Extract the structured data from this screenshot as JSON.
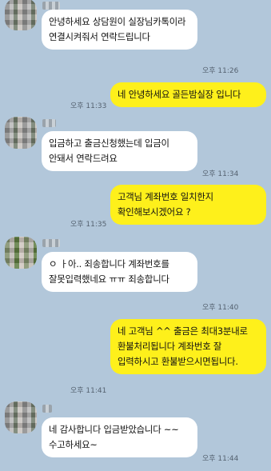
{
  "messages": [
    {
      "side": "in",
      "text": "안녕하세요 상담원이 실장님카톡이라 연결시켜줘서 연락드립니다",
      "time": "오후 11:26"
    },
    {
      "side": "out",
      "text": "네 안녕하세요 골든밤실장 입니다",
      "time": "오후 11:33"
    },
    {
      "side": "in",
      "text": "입금하고 출금신청했는데 입금이 안돼서 연락드려요",
      "time": "오후 11:34"
    },
    {
      "side": "out",
      "text": "고객님 계좌번호 일치한지 확인해보시겠어요 ?",
      "time": "오후 11:35"
    },
    {
      "side": "in",
      "text": "ㅇ ㅏ아.. 죄송합니다 계좌번호를 잘못입력했네요 ㅠㅠ 죄송합니다",
      "time": "오후 11:40"
    },
    {
      "side": "out",
      "text": "네 고객님 ^^ 출금은 최대3분내로 환불처리됩니다 계좌번호 잘 입력하시고 환불받으시면됩니다.",
      "time": "오후 11:41"
    },
    {
      "side": "in",
      "text": "네 감사합니다 입금받았습니다 ~~수고하세요~",
      "time": "오후 11:44"
    }
  ]
}
